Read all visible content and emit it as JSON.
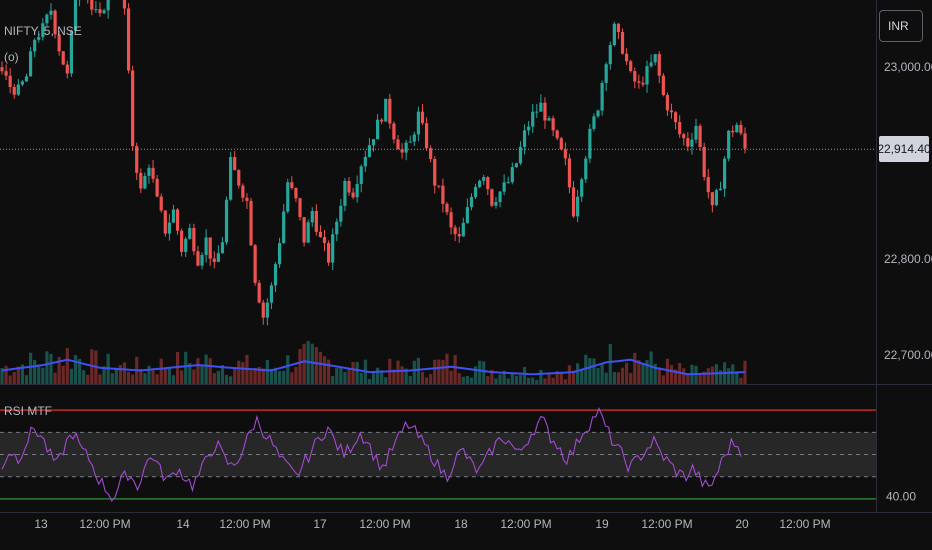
{
  "symbol_label": "NIFTY, 5, NSE",
  "sub_label": "(o)",
  "currency_button": "INR",
  "last_price": "22,914.40",
  "rsi_label": "RSI MTF",
  "colors": {
    "bg": "#0e0e0e",
    "up": "#26a69a",
    "down": "#ef5350",
    "vol_ma": "#3f51f5",
    "rsi_line": "#a24bd1",
    "overbought": "#c62828",
    "oversold": "#2e7d32",
    "band": "#2a2a2a",
    "text": "#b2b5be"
  },
  "chart_data": [
    {
      "type": "candlestick",
      "title": "",
      "y_ticks": [
        22700,
        22800,
        23000
      ],
      "y_tick_labels": [
        "22,700.00",
        "22,800.00",
        "23,000.00"
      ],
      "ylim": [
        22680,
        23070
      ],
      "x_ticks": [
        "13",
        "12:00 PM",
        "14",
        "12:00 PM",
        "17",
        "12:00 PM",
        "18",
        "12:00 PM",
        "19",
        "12:00 PM",
        "20",
        "12:00 PM"
      ],
      "close_path": [
        [
          0,
          22995
        ],
        [
          2,
          22980
        ],
        [
          4,
          22975
        ],
        [
          6,
          22990
        ],
        [
          8,
          23030
        ],
        [
          10,
          23040
        ],
        [
          12,
          23060
        ],
        [
          14,
          23020
        ],
        [
          16,
          22990
        ],
        [
          18,
          23075
        ],
        [
          20,
          23090
        ],
        [
          22,
          23060
        ],
        [
          24,
          23050
        ],
        [
          26,
          23080
        ],
        [
          28,
          23095
        ],
        [
          30,
          23060
        ],
        [
          32,
          22920
        ],
        [
          34,
          22870
        ],
        [
          36,
          22900
        ],
        [
          38,
          22860
        ],
        [
          40,
          22830
        ],
        [
          42,
          22850
        ],
        [
          44,
          22810
        ],
        [
          46,
          22830
        ],
        [
          48,
          22800
        ],
        [
          50,
          22820
        ],
        [
          52,
          22790
        ],
        [
          54,
          22820
        ],
        [
          56,
          22900
        ],
        [
          58,
          22880
        ],
        [
          60,
          22860
        ],
        [
          62,
          22780
        ],
        [
          64,
          22740
        ],
        [
          66,
          22770
        ],
        [
          68,
          22820
        ],
        [
          70,
          22880
        ],
        [
          72,
          22860
        ],
        [
          74,
          22820
        ],
        [
          76,
          22850
        ],
        [
          78,
          22820
        ],
        [
          80,
          22800
        ],
        [
          82,
          22840
        ],
        [
          84,
          22880
        ],
        [
          86,
          22870
        ],
        [
          88,
          22900
        ],
        [
          90,
          22920
        ],
        [
          92,
          22940
        ],
        [
          94,
          22960
        ],
        [
          96,
          22930
        ],
        [
          98,
          22910
        ],
        [
          100,
          22920
        ],
        [
          102,
          22950
        ],
        [
          104,
          22920
        ],
        [
          106,
          22880
        ],
        [
          108,
          22860
        ],
        [
          110,
          22830
        ],
        [
          112,
          22820
        ],
        [
          114,
          22850
        ],
        [
          116,
          22880
        ],
        [
          118,
          22890
        ],
        [
          120,
          22860
        ],
        [
          122,
          22870
        ],
        [
          124,
          22880
        ],
        [
          126,
          22900
        ],
        [
          128,
          22930
        ],
        [
          130,
          22950
        ],
        [
          132,
          22960
        ],
        [
          134,
          22940
        ],
        [
          136,
          22920
        ],
        [
          138,
          22900
        ],
        [
          140,
          22850
        ],
        [
          142,
          22890
        ],
        [
          144,
          22930
        ],
        [
          146,
          22960
        ],
        [
          148,
          23010
        ],
        [
          150,
          23040
        ],
        [
          152,
          23020
        ],
        [
          154,
          22990
        ],
        [
          156,
          22980
        ],
        [
          158,
          22995
        ],
        [
          160,
          23010
        ],
        [
          162,
          22970
        ],
        [
          164,
          22950
        ],
        [
          166,
          22930
        ],
        [
          168,
          22920
        ],
        [
          170,
          22940
        ],
        [
          172,
          22890
        ],
        [
          174,
          22850
        ],
        [
          176,
          22880
        ],
        [
          178,
          22930
        ],
        [
          180,
          22940
        ],
        [
          182,
          22914.4
        ]
      ],
      "volume_ma_path": [
        [
          0,
          0.25
        ],
        [
          10,
          0.35
        ],
        [
          16,
          0.45
        ],
        [
          24,
          0.3
        ],
        [
          34,
          0.25
        ],
        [
          48,
          0.35
        ],
        [
          56,
          0.3
        ],
        [
          66,
          0.25
        ],
        [
          74,
          0.42
        ],
        [
          80,
          0.35
        ],
        [
          90,
          0.22
        ],
        [
          100,
          0.25
        ],
        [
          110,
          0.32
        ],
        [
          120,
          0.22
        ],
        [
          130,
          0.18
        ],
        [
          140,
          0.22
        ],
        [
          148,
          0.4
        ],
        [
          154,
          0.45
        ],
        [
          160,
          0.3
        ],
        [
          168,
          0.18
        ],
        [
          176,
          0.2
        ],
        [
          182,
          0.22
        ]
      ]
    },
    {
      "type": "line",
      "title": "RSI MTF",
      "y_tick_labels": [
        "40.00"
      ],
      "ylim": [
        25,
        80
      ],
      "levels": {
        "overbought": 70,
        "upper_band": 60,
        "mid": 50,
        "lower_band": 40,
        "oversold": 30
      },
      "series": [
        {
          "values": [
            45,
            52,
            48,
            55,
            62,
            58,
            50,
            45,
            55,
            60,
            52,
            48,
            40,
            35,
            30,
            38,
            42,
            35,
            45,
            50,
            42,
            38,
            44,
            40,
            36,
            42,
            50,
            55,
            48,
            44,
            50,
            58,
            66,
            60,
            55,
            48,
            44,
            40,
            46,
            52,
            58,
            62,
            55,
            50,
            54,
            60,
            56,
            48,
            44,
            52,
            58,
            64,
            60,
            55,
            50,
            44,
            40,
            48,
            52,
            46,
            42,
            48,
            54,
            58,
            55,
            50,
            56,
            62,
            66,
            58,
            54,
            48,
            52,
            60,
            64,
            70,
            62,
            55,
            50,
            44,
            48,
            52,
            56,
            50,
            46,
            42,
            40,
            44,
            38,
            34,
            42,
            50,
            56,
            52
          ]
        }
      ]
    }
  ]
}
